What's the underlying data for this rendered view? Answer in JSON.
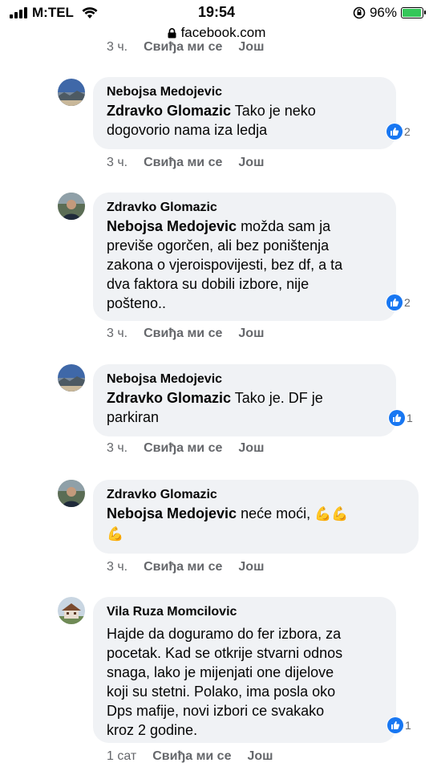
{
  "status_bar": {
    "carrier": "M:TEL",
    "time": "19:54",
    "battery": "96%"
  },
  "url_bar": {
    "url": "facebook.com"
  },
  "top_actions": {
    "time": "3 ч.",
    "like": "Свиђа ми се",
    "more": "Још"
  },
  "comments": [
    {
      "author": "Nebojsa Medojevic",
      "mention": "Zdravko Glomazic",
      "text_line_1_rest": " Tako je neko",
      "text_lines": [
        "dogovorio nama iza ledja"
      ],
      "reactions": "2",
      "time": "3 ч.",
      "like": "Свиђа ми се",
      "more": "Још",
      "avatar": "landscape-avatar"
    },
    {
      "author": "Zdravko Glomazic",
      "mention": "Nebojsa Medojevic",
      "text_line_1_rest": " možda sam ja",
      "text_lines": [
        "previše ogorčen, ali bez poništenja",
        "zakona o vjeroispovijesti, bez df, a ta",
        "dva faktora su dobili izbore, nije",
        "pošteno.."
      ],
      "reactions": "2",
      "time": "3 ч.",
      "like": "Свиђа ми се",
      "more": "Још",
      "avatar": "person-avatar"
    },
    {
      "author": "Nebojsa Medojevic",
      "mention": "Zdravko Glomazic",
      "text_line_1_rest": " Tako je. DF je",
      "text_lines": [
        "parkiran"
      ],
      "reactions": "1",
      "time": "3 ч.",
      "like": "Свиђа ми се",
      "more": "Још",
      "avatar": "landscape-avatar"
    },
    {
      "author": "Zdravko Glomazic",
      "mention": "Nebojsa Medojevic",
      "text_line_1_rest": " neće moći, ",
      "emoji_line_1": "💪💪",
      "text_lines": [
        "💪"
      ],
      "time": "3 ч.",
      "like": "Свиђа ми се",
      "more": "Још",
      "avatar": "person-avatar"
    },
    {
      "author": "Vila Ruza Momcilovic",
      "text_lines": [
        "Hajde da doguramo do fer izbora, za",
        "pocetak. Kad se otkrije stvarni odnos",
        "snaga, lako je mijenjati one dijelove",
        "koji su stetni. Polako, ima posla oko",
        "Dps mafije, novi izbori ce svakako",
        "kroz 2 godine."
      ],
      "reactions": "1",
      "time": "1 сат",
      "like": "Свиђа ми се",
      "more": "Још",
      "avatar": "house-avatar"
    }
  ],
  "colors": {
    "like_blue": "#1877f2",
    "bubble_bg": "#f0f2f5",
    "meta_gray": "#65676b",
    "battery_green": "#34c759"
  }
}
